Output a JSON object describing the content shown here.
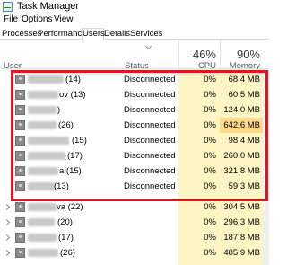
{
  "window": {
    "title": "Task Manager",
    "icon": "task-manager-icon"
  },
  "menu": [
    "File",
    "Options",
    "View"
  ],
  "tabs": [
    "Processes",
    "Performance",
    "Users",
    "Details",
    "Services"
  ],
  "active_tab": "Users",
  "columns": {
    "user": "User",
    "status": "Status",
    "cpu_total": "46%",
    "cpu": "CPU",
    "memory_total": "90%",
    "memory": "Memory"
  },
  "rows": [
    {
      "name_suffix": "(14)",
      "status": "Disconnected",
      "cpu": "0%",
      "memory": "68.4 MB"
    },
    {
      "name_suffix": "ov (13)",
      "status": "Disconnected",
      "cpu": "0%",
      "memory": "60.5 MB"
    },
    {
      "name_suffix": ")",
      "status": "Disconnected",
      "cpu": "0%",
      "memory": "124.0 MB"
    },
    {
      "name_suffix": "(26)",
      "status": "Disconnected",
      "cpu": "0%",
      "memory": "642.6 MB"
    },
    {
      "name_suffix": "(15)",
      "status": "Disconnected",
      "cpu": "0%",
      "memory": "98.4 MB"
    },
    {
      "name_suffix": "(17)",
      "status": "Disconnected",
      "cpu": "0%",
      "memory": "260.0 MB"
    },
    {
      "name_suffix": "a (15)",
      "status": "Disconnected",
      "cpu": "0%",
      "memory": "321.8 MB"
    },
    {
      "name_suffix": "(13)",
      "status": "Disconnected",
      "cpu": "0%",
      "memory": "59.3 MB"
    },
    {
      "name_suffix": "va (22)",
      "status": "",
      "cpu": "0%",
      "memory": "304.5 MB"
    },
    {
      "name_suffix": "(20)",
      "status": "",
      "cpu": "0%",
      "memory": "296.3 MB"
    },
    {
      "name_suffix": "(17)",
      "status": "",
      "cpu": "0%",
      "memory": "187.8 MB"
    },
    {
      "name_suffix": "(26)",
      "status": "",
      "cpu": "0%",
      "memory": "485.9 MB"
    }
  ],
  "highlight_color": "#e0151f"
}
